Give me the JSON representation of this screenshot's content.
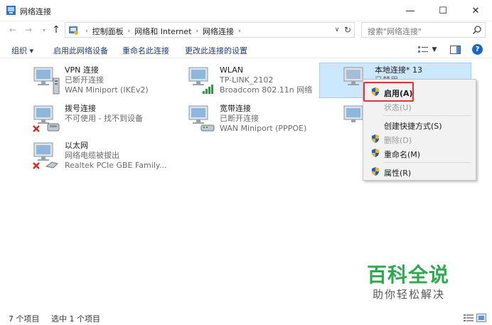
{
  "window": {
    "title": "网络连接",
    "minimize_glyph": "—",
    "maximize_glyph": "☐",
    "close_glyph": "✕"
  },
  "address": {
    "crumbs": [
      "控制面板",
      "网络和 Internet",
      "网络连接"
    ],
    "separator": "›",
    "search_placeholder": "搜索\"网络连接\""
  },
  "commands": {
    "organize": "组织 ▾",
    "enable_device": "启用此网络设备",
    "rename": "重命名此连接",
    "change_settings": "更改此连接的设置"
  },
  "connections": [
    {
      "name": "VPN 连接",
      "status": "已断开连接",
      "device": "WAN Miniport (IKEv2)",
      "icon": "vpn-connection-icon"
    },
    {
      "name": "WLAN",
      "status": "TP-LINK_2102",
      "device": "Broadcom 802.11n 网络",
      "icon": "wlan-connection-icon"
    },
    {
      "name": "本地连接* 13",
      "status": "已禁用",
      "device": "",
      "icon": "local-connection-icon"
    },
    {
      "name": "拨号连接",
      "status": "不可使用 - 找不到设备",
      "device": "",
      "icon": "dialup-connection-icon"
    },
    {
      "name": "宽带连接",
      "status": "已断开连接",
      "device": "WAN Miniport (PPPOE)",
      "icon": "broadband-connection-icon"
    },
    {
      "name": "以太网",
      "status": "网络电缆被拔出",
      "device": "Realtek PCIe GBE Family...",
      "icon": "ethernet-connection-icon"
    }
  ],
  "context_menu": {
    "enable": "启用(A)",
    "status": "状态(U)",
    "create_shortcut": "创建快捷方式(S)",
    "delete": "删除(D)",
    "rename": "重命名(M)",
    "properties": "属性(R)"
  },
  "status_bar": {
    "count": "7 个项目",
    "selected": "选中 1 个项目"
  },
  "watermark": {
    "title": "百科全说",
    "subtitle": "助你轻松解决"
  },
  "colors": {
    "accent": "#1a66c8",
    "selection": "#cce8ff",
    "highlight_border": "#e8303a",
    "watermark_green": "#2fa84f"
  }
}
